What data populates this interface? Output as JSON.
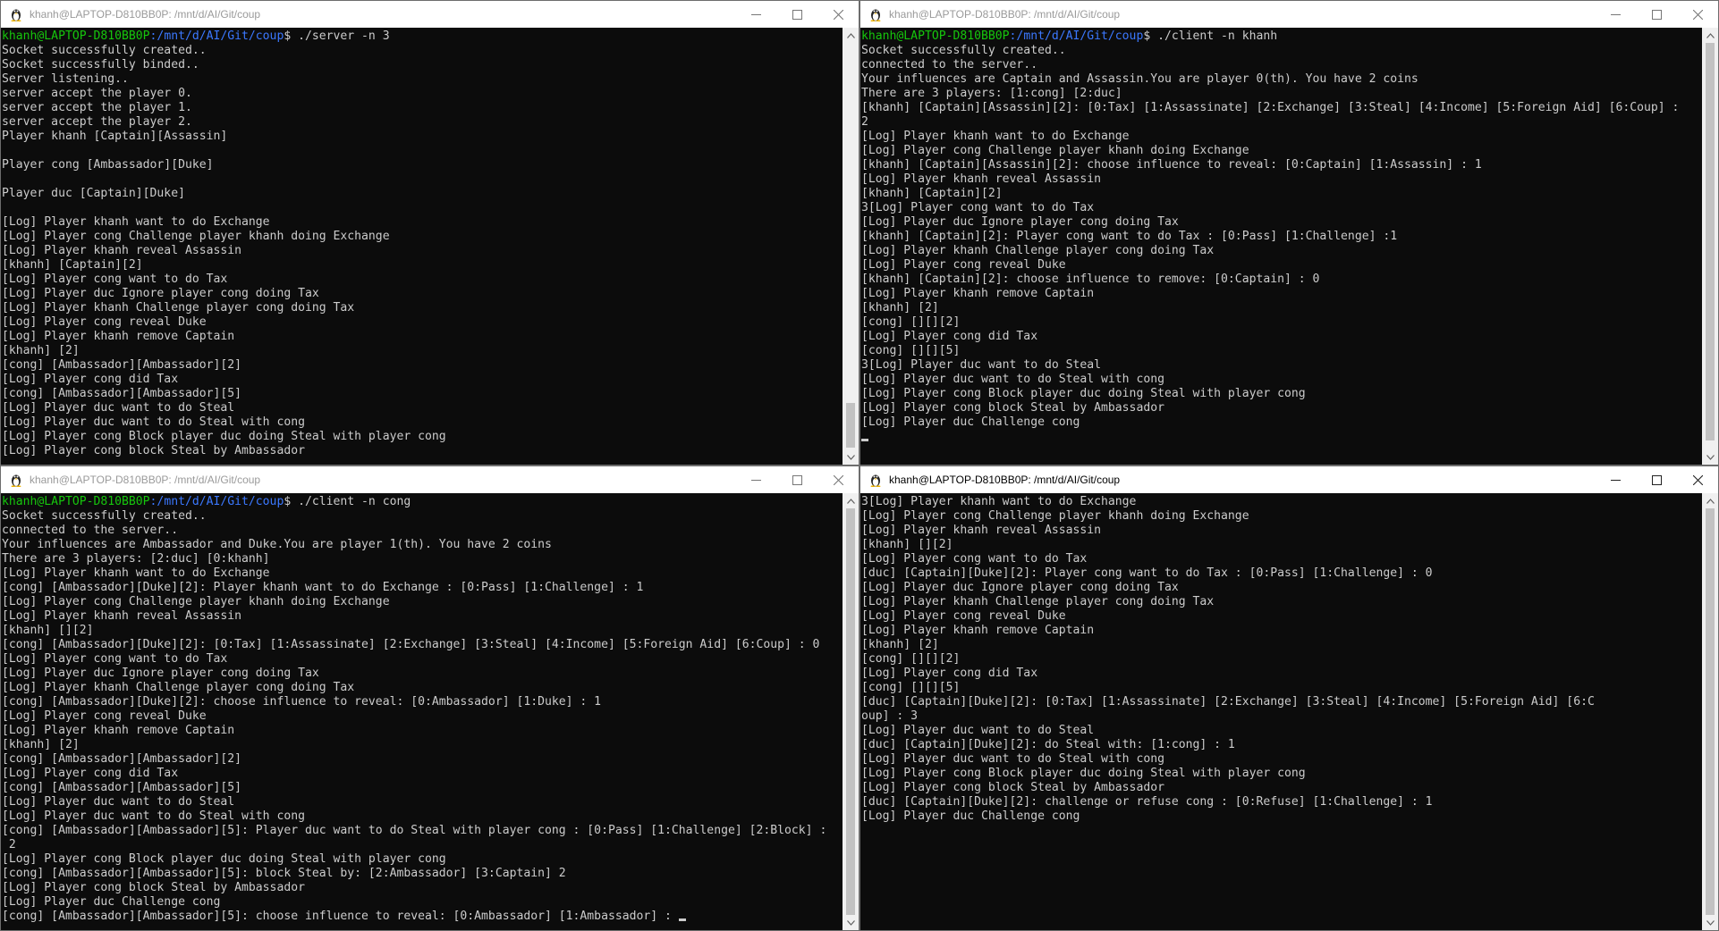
{
  "windows": [
    {
      "id": "tl",
      "title": "khanh@LAPTOP-D810BB0P: /mnt/d/AI/Git/coup",
      "active": false,
      "prompt": {
        "user": "khanh@LAPTOP-D810BB0P",
        "path": ":/mnt/d/AI/Git/coup",
        "cmd": "$ ./server -n 3"
      },
      "lines": [
        "Socket successfully created..",
        "Socket successfully binded..",
        "Server listening..",
        "server accept the player 0.",
        "server accept the player 1.",
        "server accept the player 2.",
        "Player khanh [Captain][Assassin]",
        "",
        "Player cong [Ambassador][Duke]",
        "",
        "Player duc [Captain][Duke]",
        "",
        "[Log] Player khanh want to do Exchange",
        "[Log] Player cong Challenge player khanh doing Exchange",
        "[Log] Player khanh reveal Assassin",
        "[khanh] [Captain][2]",
        "[Log] Player cong want to do Tax",
        "[Log] Player duc Ignore player cong doing Tax",
        "[Log] Player khanh Challenge player cong doing Tax",
        "[Log] Player cong reveal Duke",
        "[Log] Player khanh remove Captain",
        "[khanh] [2]",
        "[cong] [Ambassador][Ambassador][2]",
        "[Log] Player cong did Tax",
        "[cong] [Ambassador][Ambassador][5]",
        "[Log] Player duc want to do Steal",
        "[Log] Player duc want to do Steal with cong",
        "[Log] Player cong Block player duc doing Steal with player cong",
        "[Log] Player cong block Steal by Ambassador"
      ],
      "cursor": false
    },
    {
      "id": "tr",
      "title": "khanh@LAPTOP-D810BB0P: /mnt/d/AI/Git/coup",
      "active": false,
      "prompt": {
        "user": "khanh@LAPTOP-D810BB0P",
        "path": ":/mnt/d/AI/Git/coup",
        "cmd": "$ ./client -n khanh"
      },
      "lines": [
        "Socket successfully created..",
        "connected to the server..",
        "Your influences are Captain and Assassin.You are player 0(th). You have 2 coins",
        "There are 3 players: [1:cong] [2:duc]",
        "[khanh] [Captain][Assassin][2]: [0:Tax] [1:Assassinate] [2:Exchange] [3:Steal] [4:Income] [5:Foreign Aid] [6:Coup] :",
        "2",
        "[Log] Player khanh want to do Exchange",
        "[Log] Player cong Challenge player khanh doing Exchange",
        "[khanh] [Captain][Assassin][2]: choose influence to reveal: [0:Captain] [1:Assassin] : 1",
        "[Log] Player khanh reveal Assassin",
        "[khanh] [Captain][2]",
        "3[Log] Player cong want to do Tax",
        "[Log] Player duc Ignore player cong doing Tax",
        "[khanh] [Captain][2]: Player cong want to do Tax : [0:Pass] [1:Challenge] :1",
        "[Log] Player khanh Challenge player cong doing Tax",
        "[Log] Player cong reveal Duke",
        "[khanh] [Captain][2]: choose influence to remove: [0:Captain] : 0",
        "[Log] Player khanh remove Captain",
        "[khanh] [2]",
        "[cong] [][][2]",
        "[Log] Player cong did Tax",
        "[cong] [][][5]",
        "3[Log] Player duc want to do Steal",
        "[Log] Player duc want to do Steal with cong",
        "[Log] Player cong Block player duc doing Steal with player cong",
        "[Log] Player cong block Steal by Ambassador",
        "[Log] Player duc Challenge cong"
      ],
      "cursor": true
    },
    {
      "id": "bl",
      "title": "khanh@LAPTOP-D810BB0P: /mnt/d/AI/Git/coup",
      "active": false,
      "prompt": {
        "user": "khanh@LAPTOP-D810BB0P",
        "path": ":/mnt/d/AI/Git/coup",
        "cmd": "$ ./client -n cong"
      },
      "lines": [
        "Socket successfully created..",
        "connected to the server..",
        "Your influences are Ambassador and Duke.You are player 1(th). You have 2 coins",
        "There are 3 players: [2:duc] [0:khanh]",
        "[Log] Player khanh want to do Exchange",
        "[cong] [Ambassador][Duke][2]: Player khanh want to do Exchange : [0:Pass] [1:Challenge] : 1",
        "[Log] Player cong Challenge player khanh doing Exchange",
        "[Log] Player khanh reveal Assassin",
        "[khanh] [][2]",
        "[cong] [Ambassador][Duke][2]: [0:Tax] [1:Assassinate] [2:Exchange] [3:Steal] [4:Income] [5:Foreign Aid] [6:Coup] : 0",
        "[Log] Player cong want to do Tax",
        "[Log] Player duc Ignore player cong doing Tax",
        "[Log] Player khanh Challenge player cong doing Tax",
        "[cong] [Ambassador][Duke][2]: choose influence to reveal: [0:Ambassador] [1:Duke] : 1",
        "[Log] Player cong reveal Duke",
        "[Log] Player khanh remove Captain",
        "[khanh] [2]",
        "[cong] [Ambassador][Ambassador][2]",
        "[Log] Player cong did Tax",
        "[cong] [Ambassador][Ambassador][5]",
        "[Log] Player duc want to do Steal",
        "[Log] Player duc want to do Steal with cong",
        "[cong] [Ambassador][Ambassador][5]: Player duc want to do Steal with player cong : [0:Pass] [1:Challenge] [2:Block] :",
        " 2",
        "[Log] Player cong Block player duc doing Steal with player cong",
        "[cong] [Ambassador][Ambassador][5]: block Steal by: [2:Ambassador] [3:Captain] 2",
        "[Log] Player cong block Steal by Ambassador",
        "[Log] Player duc Challenge cong",
        "[cong] [Ambassador][Ambassador][5]: choose influence to reveal: [0:Ambassador] [1:Ambassador] : "
      ],
      "cursor": true
    },
    {
      "id": "br",
      "title": "khanh@LAPTOP-D810BB0P: /mnt/d/AI/Git/coup",
      "active": true,
      "prompt": null,
      "lines": [
        "3[Log] Player khanh want to do Exchange",
        "[Log] Player cong Challenge player khanh doing Exchange",
        "[Log] Player khanh reveal Assassin",
        "[khanh] [][2]",
        "[Log] Player cong want to do Tax",
        "[duc] [Captain][Duke][2]: Player cong want to do Tax : [0:Pass] [1:Challenge] : 0",
        "[Log] Player duc Ignore player cong doing Tax",
        "[Log] Player khanh Challenge player cong doing Tax",
        "[Log] Player cong reveal Duke",
        "[Log] Player khanh remove Captain",
        "[khanh] [2]",
        "[cong] [][][2]",
        "[Log] Player cong did Tax",
        "[cong] [][][5]",
        "[duc] [Captain][Duke][2]: [0:Tax] [1:Assassinate] [2:Exchange] [3:Steal] [4:Income] [5:Foreign Aid] [6:C",
        "oup] : 3",
        "[Log] Player duc want to do Steal",
        "[duc] [Captain][Duke][2]: do Steal with: [1:cong] : 1",
        "[Log] Player duc want to do Steal with cong",
        "[Log] Player cong Block player duc doing Steal with player cong",
        "[Log] Player cong block Steal by Ambassador",
        "[duc] [Captain][Duke][2]: challenge or refuse cong : [0:Refuse] [1:Challenge] : 1",
        "[Log] Player duc Challenge cong"
      ],
      "cursor": false
    }
  ]
}
